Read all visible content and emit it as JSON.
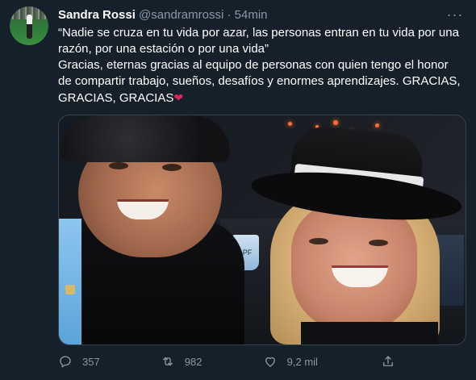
{
  "tweet": {
    "author": {
      "name": "Sandra Rossi",
      "handle": "@sandramrossi",
      "separator": "·",
      "time": "54min"
    },
    "text": "“Nadie se cruza en tu vida por azar, las personas entran en tu vida por una razón, por una estación o por una vida”\nGracias, eternas gracias al equipo de personas con quien tengo el honor  de compartir trabajo, sueños, desafíos y enormes aprendizajes. GRACIAS, GRACIAS, GRACIAS",
    "heart_emoji": "❤",
    "more_label": "···"
  },
  "actions": {
    "reply_count": "357",
    "retweet_count": "982",
    "like_count": "9,2 mil"
  },
  "icons": {
    "reply": "reply-icon",
    "retweet": "retweet-icon",
    "like": "heart-icon",
    "share": "share-icon"
  },
  "colors": {
    "background": "#15202b",
    "secondary_text": "#8b98a5",
    "heart": "#e0245e"
  }
}
